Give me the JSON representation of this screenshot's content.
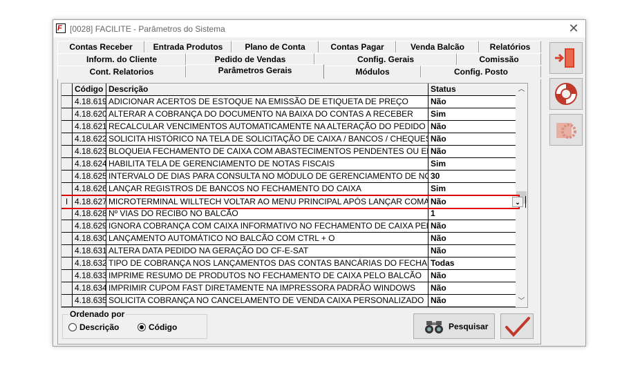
{
  "window": {
    "title": "[0028] FACILITE - Parâmetros do Sistema",
    "icon_letter": "F"
  },
  "tabs": {
    "row1": [
      "Contas Receber",
      "Entrada Produtos",
      "Plano de Conta",
      "Contas Pagar",
      "Venda Balcão",
      "Relatórios"
    ],
    "row2": [
      "Inform. do Cliente",
      "Pedido de Vendas",
      "Config. Gerais",
      "Comissão"
    ],
    "row3": [
      "Cont. Relatorios",
      "Parâmetros Gerais",
      "Módulos",
      "Config. Posto"
    ],
    "active": "Parâmetros Gerais"
  },
  "grid": {
    "headers": {
      "code": "Código",
      "description": "Descrição",
      "status": "Status"
    },
    "rows": [
      {
        "code": "4.18.619",
        "description": "ADICIONAR ACERTOS DE ESTOQUE NA EMISSÃO DE ETIQUETA DE PREÇO",
        "status": "Não"
      },
      {
        "code": "4.18.620",
        "description": "ALTERAR A COBRANÇA DO DOCUMENTO NA BAIXA DO CONTAS A RECEBER",
        "status": "Sim"
      },
      {
        "code": "4.18.621",
        "description": "RECALCULAR VENCIMENTOS AUTOMATICAMENTE NA ALTERAÇÃO DO PEDIDO DE VENDA",
        "status": "Não"
      },
      {
        "code": "4.18.622",
        "description": "SOLICITA HISTÓRICO NA TELA DE SOLICITAÇÃO DE CAIXA / BANCOS / CHEQUES",
        "status": "Não"
      },
      {
        "code": "4.18.623",
        "description": "BLOQUEIA FECHAMENTO DE CAIXA COM ABASTECIMENTOS PENDENTES OU EM ABASTE",
        "status": "Não"
      },
      {
        "code": "4.18.624",
        "description": "HABILITA TELA DE GERENCIAMENTO DE NOTAS FISCAIS",
        "status": "Sim"
      },
      {
        "code": "4.18.625",
        "description": "INTERVALO DE DIAS PARA CONSULTA NO MÓDULO DE GERENCIAMENTO DE NOTA FISCA",
        "status": "30"
      },
      {
        "code": "4.18.626",
        "description": "LANÇAR REGISTROS DE BANCOS NO FECHAMENTO DO CAIXA",
        "status": "Sim"
      },
      {
        "code": "4.18.627",
        "description": "MICROTERMINAL WILLTECH VOLTAR AO MENU PRINCIPAL APÓS LANÇAR COMANDA",
        "status": "Não",
        "selected": true,
        "indicator": "I"
      },
      {
        "code": "4.18.628",
        "description": "Nº VIAS DO RECIBO NO BALCÃO",
        "status": "1"
      },
      {
        "code": "4.18.629",
        "description": "IGNORA COBRANÇA COM CAIXA INFORMATIVO NO FECHAMENTO DE CAIXA PELO RETAGU",
        "status": "Não"
      },
      {
        "code": "4.18.630",
        "description": "LANÇAMENTO AUTOMÁTICO NO BALCÃO COM CTRL + O",
        "status": "Não"
      },
      {
        "code": "4.18.631",
        "description": "ALTERA DATA PEDIDO NA GERAÇÃO DO CF-E-SAT",
        "status": "Não"
      },
      {
        "code": "4.18.632",
        "description": "TIPO DE COBRANÇA NOS LANÇAMENTOS DAS CONTAS BANCÁRIAS DO FECHAMENTO DE",
        "status": "Todas"
      },
      {
        "code": "4.18.633",
        "description": "IMPRIME RESUMO DE PRODUTOS NO FECHAMENTO DE CAIXA PELO BALCÃO",
        "status": "Não"
      },
      {
        "code": "4.18.634",
        "description": "IMPRIMIR CUPOM FAST DIRETAMENTE NA IMPRESSORA PADRÃO WINDOWS",
        "status": "Não"
      },
      {
        "code": "4.18.635",
        "description": "SOLICITA COBRANÇA NO CANCELAMENTO DE VENDA CAIXA PERSONALIZADO",
        "status": "Não"
      }
    ]
  },
  "order": {
    "legend": "Ordenado por",
    "options": [
      "Descrição",
      "Código"
    ],
    "selected": "Código"
  },
  "buttons": {
    "search": "Pesquisar"
  },
  "icons": {
    "exit": "exit-door-icon",
    "help": "lifebuoy-icon",
    "settings": "gear-icon",
    "search": "binoculars-icon",
    "confirm": "checkmark-icon"
  },
  "colors": {
    "selection_border": "#e00000",
    "confirm_check": "#c0392b",
    "exit_icon": "#d9412b"
  }
}
